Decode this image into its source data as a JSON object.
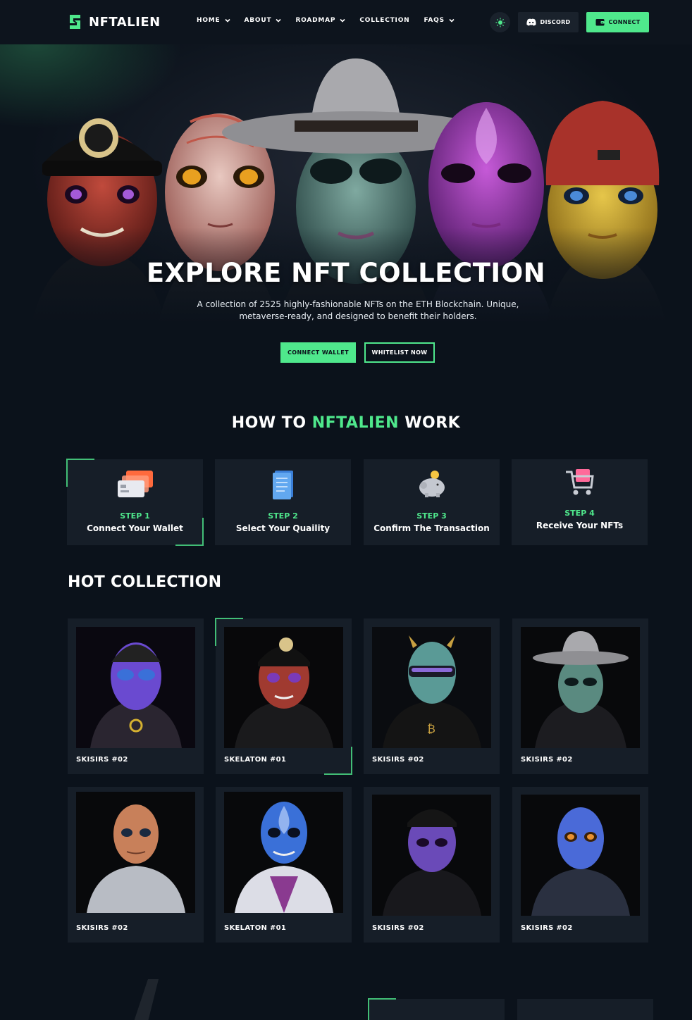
{
  "brand": {
    "name": "NFTALIEN",
    "accent": "#4fe88c",
    "background": "#0b121b"
  },
  "nav": {
    "items": [
      {
        "label": "HOME",
        "has_dropdown": true
      },
      {
        "label": "ABOUT",
        "has_dropdown": true
      },
      {
        "label": "ROADMAP",
        "has_dropdown": true
      },
      {
        "label": "COLLECTION",
        "has_dropdown": false
      },
      {
        "label": "FAQS",
        "has_dropdown": true
      }
    ],
    "theme_toggle_icon": "sun-icon",
    "discord_label": "DISCORD",
    "connect_label": "CONNECT"
  },
  "hero": {
    "title": "EXPLORE NFT COLLECTION",
    "subtitle_line1": "A collection of 2525 highly-fashionable NFTs on the ETH Blockchain. Unique,",
    "subtitle_line2": "metaverse-ready, and designed to benefit their holders.",
    "primary_button": "CONNECT WALLET",
    "secondary_button": "WHITELIST NOW"
  },
  "how": {
    "title_before": "HOW TO ",
    "title_accent": "NFTALIEN",
    "title_after": " WORK",
    "steps": [
      {
        "label": "STEP 1",
        "title": "Connect Your Wallet",
        "icon": "wallet-cards-icon"
      },
      {
        "label": "STEP 2",
        "title": "Select Your Quaility",
        "icon": "document-icon"
      },
      {
        "label": "STEP 3",
        "title": "Confirm The Transaction",
        "icon": "piggy-bank-icon"
      },
      {
        "label": "STEP 4",
        "title": "Receive Your NFTs",
        "icon": "shopping-cart-icon"
      }
    ]
  },
  "hot": {
    "title": "HOT COLLECTION",
    "items": [
      {
        "name": "SKISIRS #02"
      },
      {
        "name": "SKELATON #01"
      },
      {
        "name": "SKISIRS #02"
      },
      {
        "name": "SKISIRS #02"
      },
      {
        "name": "SKISIRS #02"
      },
      {
        "name": "SKELATON #01"
      },
      {
        "name": "SKISIRS #02"
      },
      {
        "name": "SKISIRS #02"
      }
    ]
  }
}
